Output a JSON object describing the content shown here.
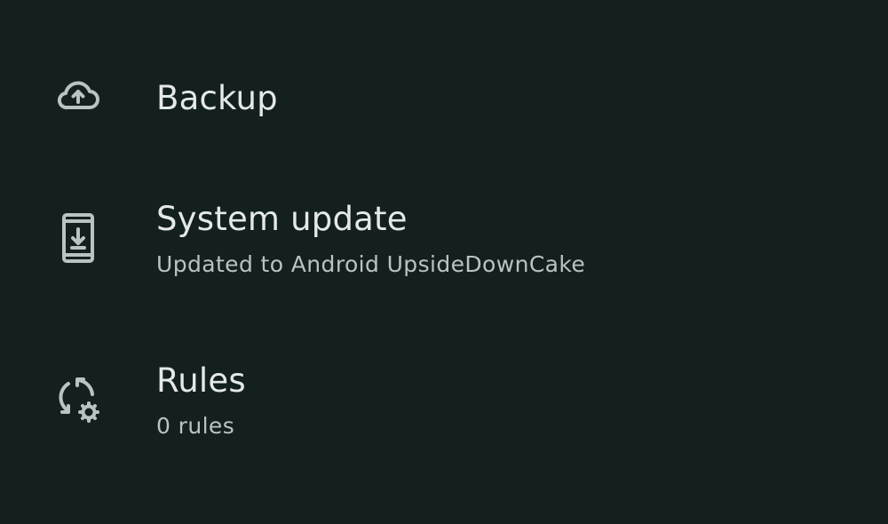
{
  "settings": {
    "items": [
      {
        "icon": "cloud-upload-icon",
        "title": "Backup",
        "summary": ""
      },
      {
        "icon": "system-update-icon",
        "title": "System update",
        "summary": "Updated to Android UpsideDownCake"
      },
      {
        "icon": "rules-icon",
        "title": "Rules",
        "summary": "0 rules"
      }
    ]
  },
  "colors": {
    "background": "#142020",
    "title_text": "#e4e9e7",
    "summary_text": "#b9c4c1",
    "icon": "#b9c4c1"
  }
}
